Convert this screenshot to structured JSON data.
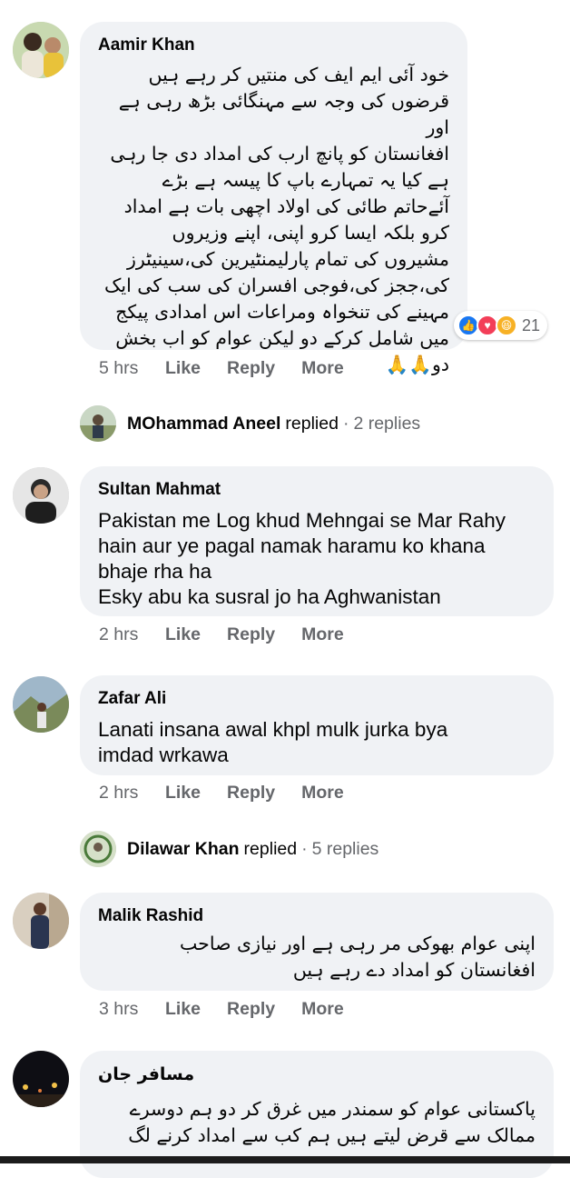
{
  "comments": [
    {
      "author": "Aamir Khan",
      "text": "خود آئی ایم ایف کی منتیں کر رہے ہیں\nقرضوں کی وجہ سے مہنگائی بڑھ رہی ہے اور\nافغانستان کو پانچ ارب کی امداد دی جا رہی\nہے کیا یہ تمہارے باپ کا پیسہ ہے بڑے\nآئےحاتم طائی کی اولاد اچھی بات ہے امداد\nکرو بلکہ ایسا کرو اپنی، اپنے وزیروں\nمشیروں کی تمام پارلیمنٹیرین کی،سینیٹرز\nکی،ججز کی،فوجی افسران کی سب کی ایک\nمہینے کی تنخواہ ومراعات اس امدادی پیکج\nمیں شامل کرکے دو لیکن عوام کو اب بخش\nدو🙏🙏",
      "reaction_count": "21",
      "time": "5 hrs",
      "like": "Like",
      "reply": "Reply",
      "more": "More"
    },
    {
      "author": "Sultan Mahmat",
      "text": "Pakistan me Log khud Mehngai se Mar Rahy\nhain aur ye pagal namak haramu ko khana\nbhaje rha ha\nEsky abu ka susral jo ha Aghwanistan",
      "time": "2 hrs",
      "like": "Like",
      "reply": "Reply",
      "more": "More"
    },
    {
      "author": "Zafar Ali",
      "text": "Lanati insana awal khpl mulk jurka bya\nimdad wrkawa",
      "time": "2 hrs",
      "like": "Like",
      "reply": "Reply",
      "more": "More"
    },
    {
      "author": "Malik Rashid",
      "text": "اپنی عوام بھوکی مر رہی ہے اور نیازی صاحب\nافغانستان کو امداد دے رہے ہیں",
      "time": "3 hrs",
      "like": "Like",
      "reply": "Reply",
      "more": "More"
    },
    {
      "author": "مسافر جان",
      "text": "پاکستانی عوام کو سمندر میں غرق کر دو ہم دوسرے\nممالک سے قرض لیتے ہیں ہم کب سے امداد کرنے لگ"
    }
  ],
  "replies": [
    {
      "name": "MOhammad Aneel",
      "word": "replied",
      "count": "2 replies"
    },
    {
      "name": "Dilawar Khan",
      "word": "replied",
      "count": "5 replies"
    }
  ],
  "colors": {
    "bubble": "#f0f2f5",
    "meta": "#65676b",
    "like_blue": "#1877f2",
    "love_red": "#f33e58",
    "haha_yellow": "#f7b125"
  },
  "icons": [
    "like-reaction-icon",
    "love-reaction-icon",
    "haha-reaction-icon"
  ]
}
